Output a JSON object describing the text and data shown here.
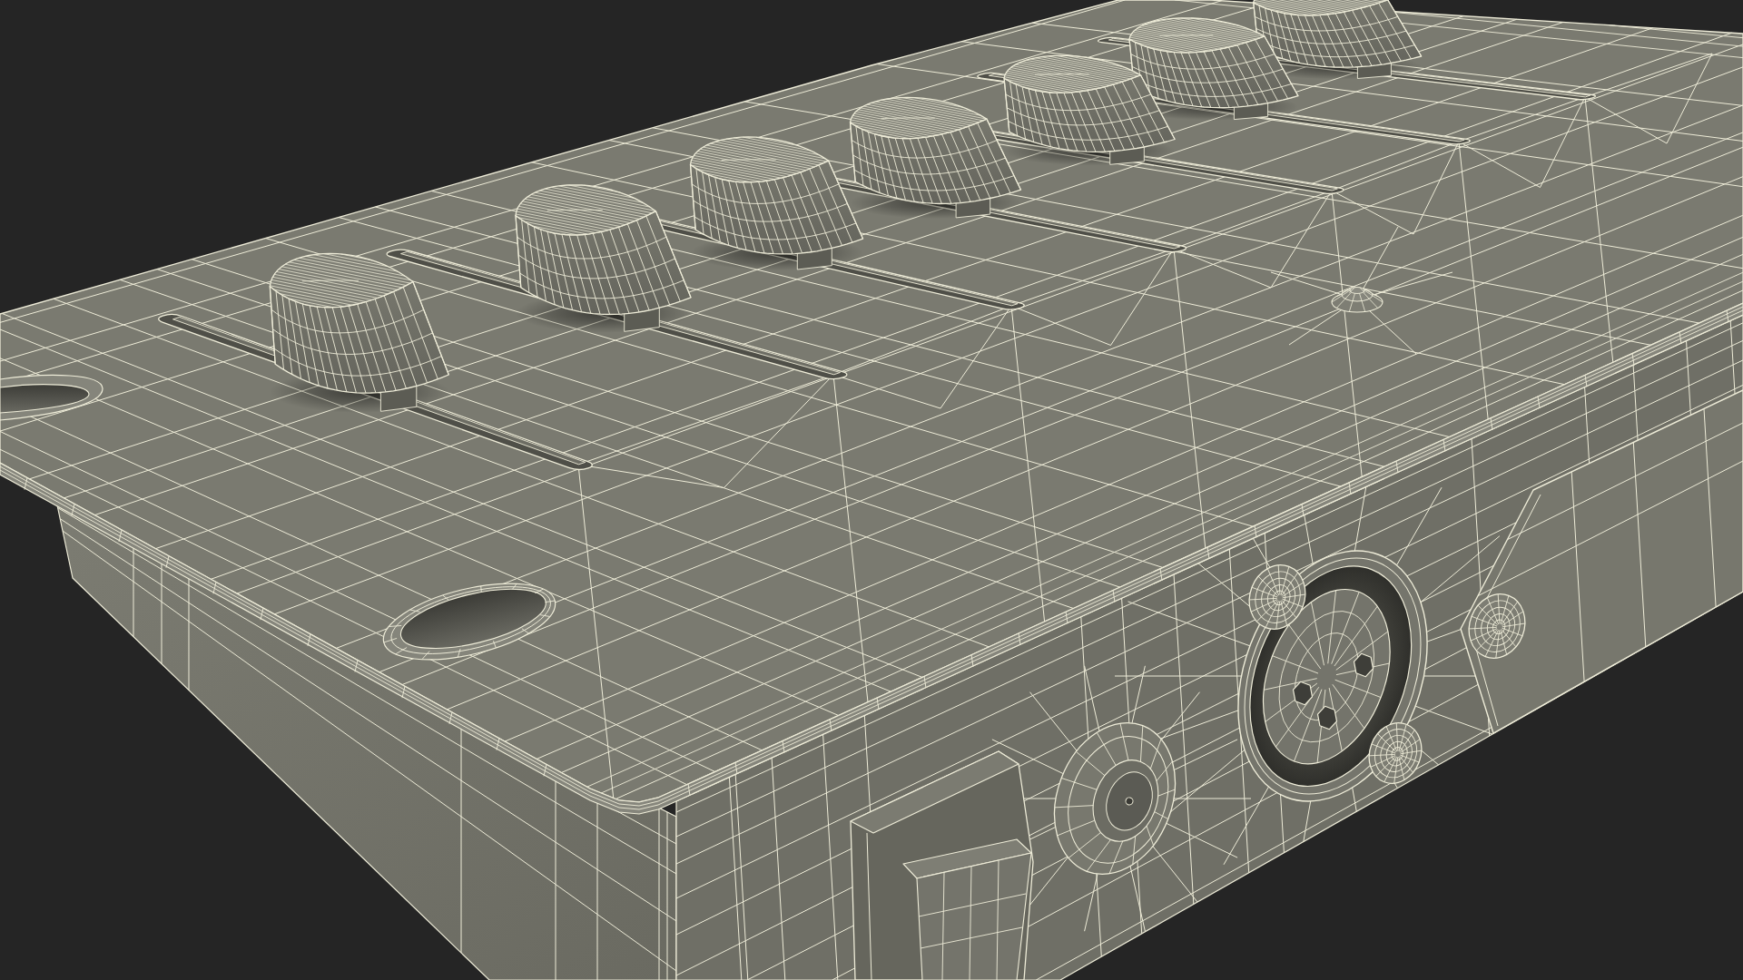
{
  "device": {
    "faders": [
      {
        "level": 0.44
      },
      {
        "level": 0.44
      },
      {
        "level": 0.44
      },
      {
        "level": 0.44
      },
      {
        "level": 0.44
      },
      {
        "level": 0.44
      },
      {
        "level": 0.44
      }
    ],
    "power_switch": {
      "on": false
    }
  }
}
